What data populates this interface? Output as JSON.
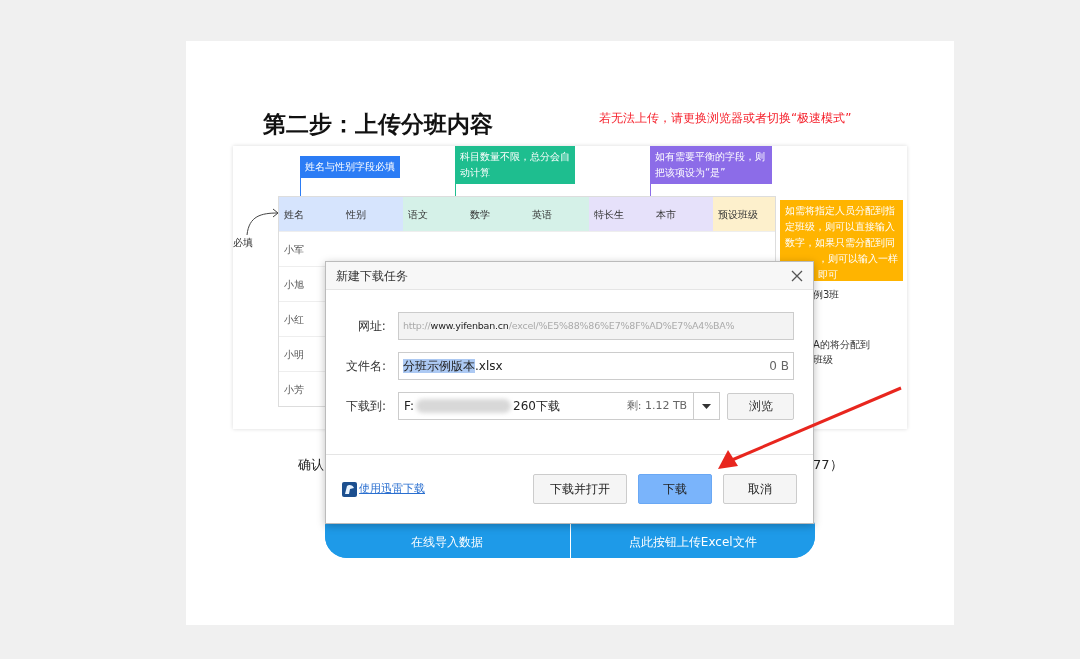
{
  "heading": "第二步：上传分班内容",
  "notice": "若无法上传，请更换浏览器或者切换“极速模式”",
  "example": {
    "callouts": [
      {
        "kind": "top",
        "color": "#2b7cf5",
        "lines": [
          "姓名与性别字段必填"
        ]
      },
      {
        "kind": "top",
        "color": "#1ebe8f",
        "lines": [
          "科目数量不限，总分会自",
          "动计算"
        ]
      },
      {
        "kind": "top",
        "color": "#8c6ce8",
        "lines": [
          "如有需要平衡的字段，则",
          "把该项设为“是”"
        ]
      },
      {
        "kind": "side",
        "color": "#ffb400",
        "lines": [
          "如需将指定人员分配到指",
          "定班级，则可以直接输入",
          "数字，如果只需分配到同",
          "，则可以输入一样",
          "即可"
        ]
      }
    ],
    "required_label": "必填",
    "columns": [
      {
        "label": "姓名",
        "color": "#d6e4fd"
      },
      {
        "label": "性别",
        "color": "#d6e4fd"
      },
      {
        "label": "语文",
        "color": "#d5f1e8"
      },
      {
        "label": "数学",
        "color": "#d5f1e8"
      },
      {
        "label": "英语",
        "color": "#d5f1e8"
      },
      {
        "label": "特长生",
        "color": "#e6e1fa"
      },
      {
        "label": "本市",
        "color": "#e6e1fa"
      },
      {
        "label": "预设班级",
        "color": "#fdf0cc"
      }
    ],
    "row_names": [
      "小军",
      "小旭",
      "小红",
      "小明",
      "小芳"
    ],
    "side_notes": [
      "例3班",
      "A的将分配到",
      "班级"
    ]
  },
  "confirm_left": "确认",
  "confirm_right": "77）",
  "upload_buttons": [
    "在线导入数据",
    "点此按钮上传Excel文件"
  ],
  "dialog": {
    "title": "新建下载任务",
    "url_label": "网址:",
    "url_parts": [
      {
        "kind": "muted",
        "text": "http://"
      },
      {
        "kind": "host",
        "text": "www.yifenban.cn"
      },
      {
        "kind": "muted",
        "text": "/excel/%E5%88%86%E7%8F%AD%E7%A4%BA%"
      }
    ],
    "name_label": "文件名:",
    "name_selected": "分班示例版本",
    "name_rest": ".xlsx",
    "size": "0 B",
    "dest_label": "下载到:",
    "dest_start": "F:",
    "dest_end": "260下载",
    "free": "剩: 1.12 TB",
    "browse": "浏览",
    "thunder_link": "使用迅雷下载",
    "buttons": [
      {
        "label": "下载并打开",
        "primary": false
      },
      {
        "label": "下载",
        "primary": true
      },
      {
        "label": "取消",
        "primary": false
      }
    ]
  }
}
